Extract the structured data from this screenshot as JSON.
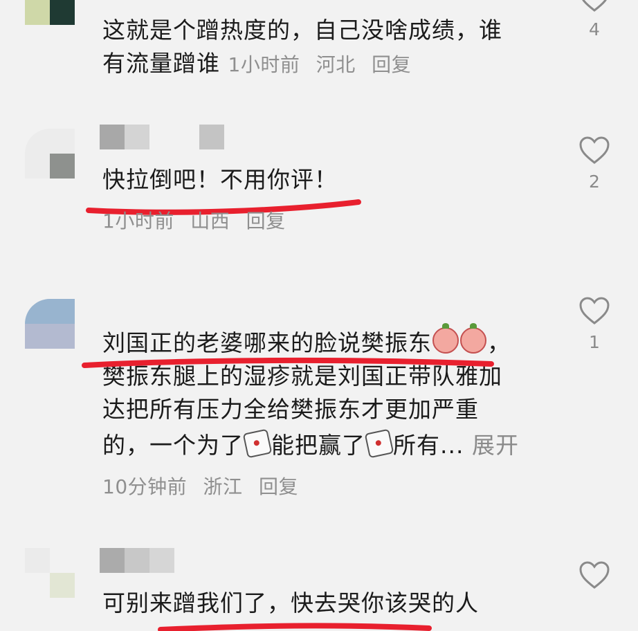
{
  "comments": [
    {
      "text_lines": [
        "这就是个蹭热度的，自己没啥成绩，谁",
        "有流量蹭谁"
      ],
      "time": "1小时前",
      "location": "河北",
      "reply_label": "回复",
      "likes": "4"
    },
    {
      "text": "快拉倒吧！不用你评！",
      "time": "1小时前",
      "location": "山西",
      "reply_label": "回复",
      "likes": "2"
    },
    {
      "text_line1": "刘国正的老婆哪来的脸说樊振东",
      "text_line1_end": "，",
      "text_line2": "樊振东腿上的湿疹就是刘国正带队雅加",
      "text_line3": "达把所有压力全给樊振东才更加严重",
      "text_line4_a": "的，一个为了",
      "text_line4_b": "能把赢了",
      "text_line4_c": "所有...",
      "expand_label": "展开",
      "time": "10分钟前",
      "location": "浙江",
      "reply_label": "回复",
      "likes": "1"
    },
    {
      "text": "可别来蹭我们了，快去哭你该哭的人"
    }
  ],
  "colors": {
    "underline": "#e8202e",
    "meta": "#8f8f8f",
    "background": "#f2f2f2"
  },
  "icons": {
    "like": "heart-outline-icon"
  }
}
